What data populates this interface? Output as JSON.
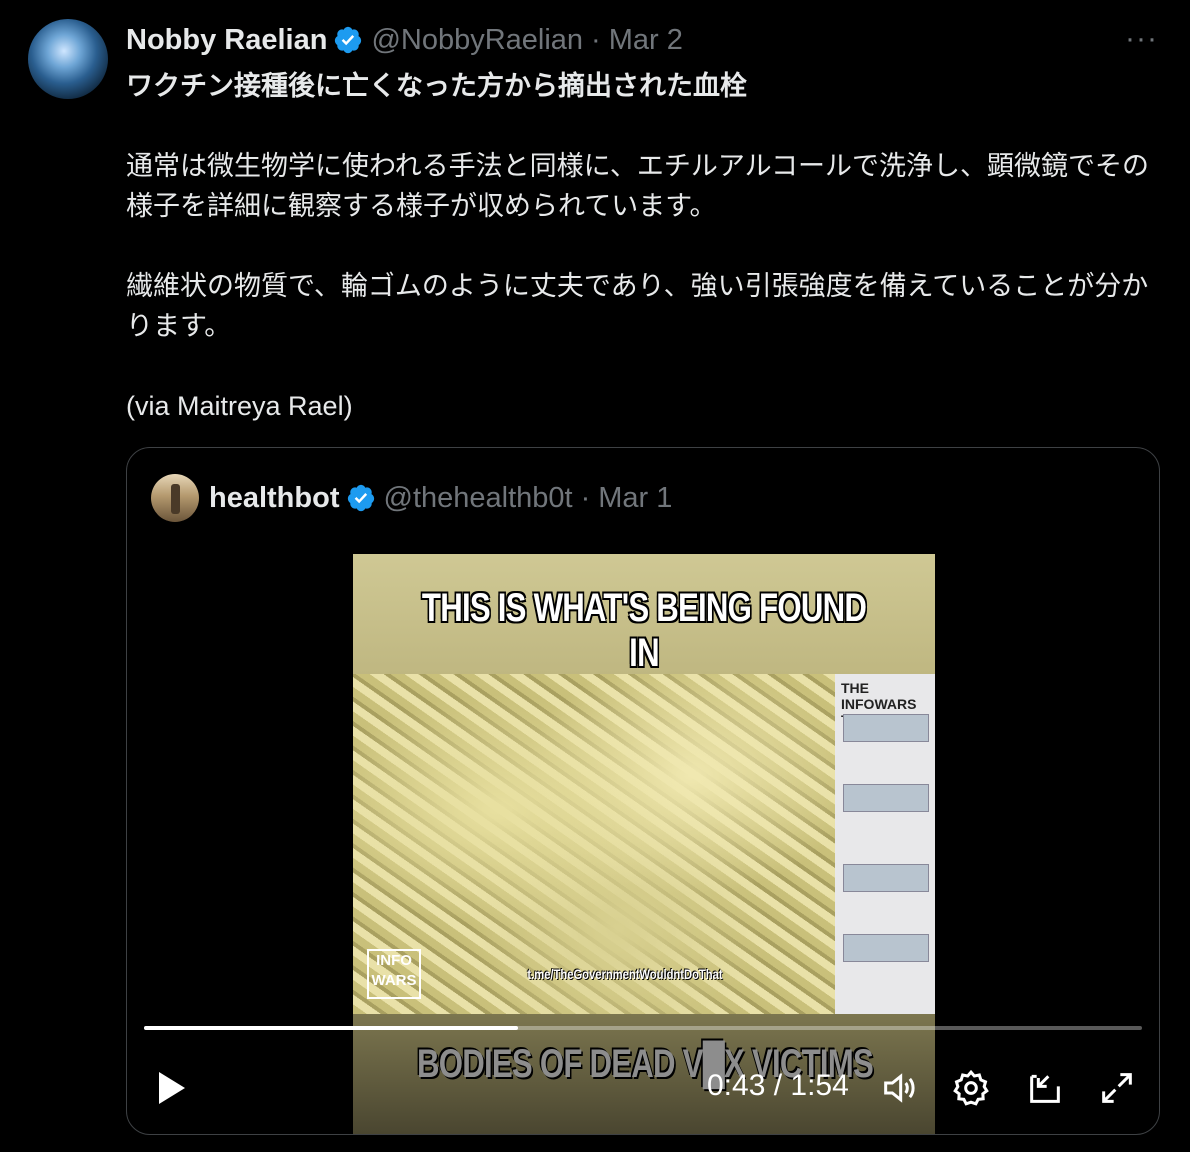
{
  "tweet": {
    "name": "Nobby Raelian",
    "handle": "@NobbyRaelian",
    "separator": "·",
    "date": "Mar 2",
    "more": "···",
    "title": "ワクチン接種後に亡くなった方から摘出された血栓",
    "paragraph1": "通常は微生物学に使われる手法と同様に、エチルアルコールで洗浄し、顕微鏡でその様子を詳細に観察する様子が収められています。",
    "paragraph2": "繊維状の物質で、輪ゴムのように丈夫であり、強い引張強度を備えていることが分かります。",
    "paragraph3": "(via Maitreya Rael)"
  },
  "quote": {
    "name": "healthbot",
    "handle": "@thehealthb0t",
    "separator": "·",
    "date": "Mar 1"
  },
  "video": {
    "top_caption": "THIS IS WHAT'S BEING FOUND IN",
    "bottom_caption": "BODIES OF DEAD V█X VICTIMS",
    "panel_brand": "THE INFOWARS TV",
    "watermark": "INFO WARS",
    "telegram": "t.me/TheGovernmentWouldntDoThat",
    "time": "0:43 / 1:54",
    "progress": 0.375
  },
  "colors": {
    "verified": "#1d9bf0",
    "muted": "#71767b",
    "text": "#e7e9ea"
  },
  "icons": [
    "verified-badge-icon",
    "more-icon",
    "play-icon",
    "volume-icon",
    "settings-icon",
    "dock-icon",
    "fullscreen-icon"
  ]
}
